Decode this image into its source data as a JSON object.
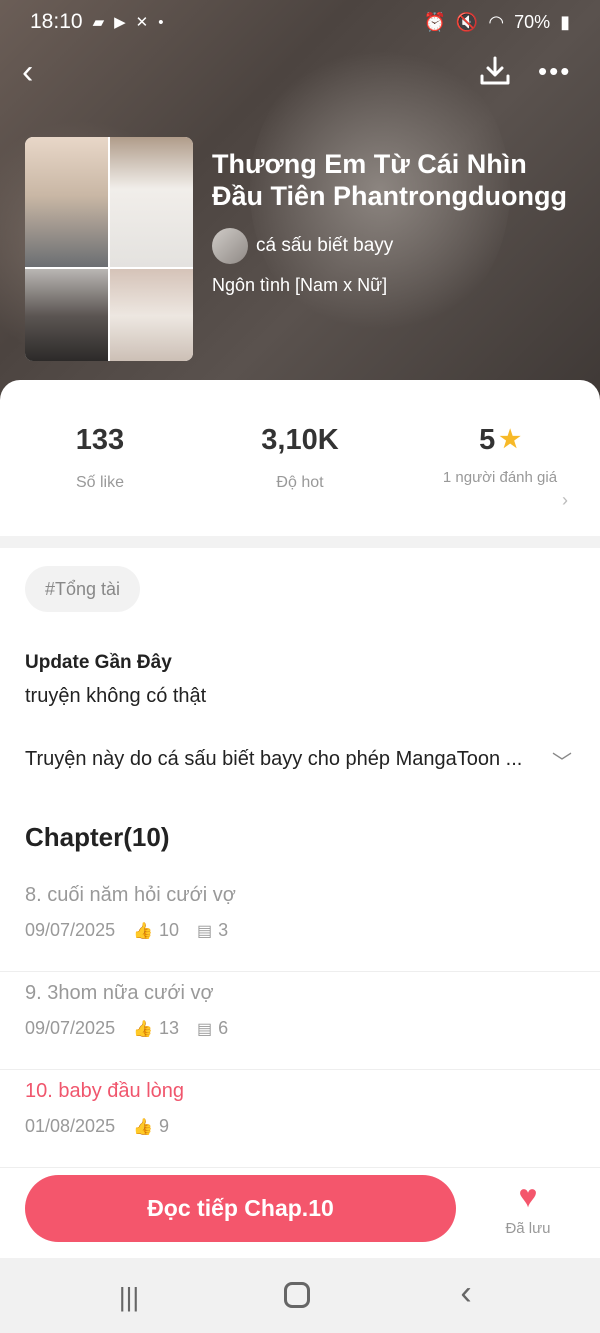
{
  "status_bar": {
    "time": "18:10",
    "battery": "70%"
  },
  "manga": {
    "title": "Thương Em Từ Cái Nhìn Đầu Tiên Phantrongduongg",
    "author": "cá sấu biết bayy",
    "genre": "Ngôn tình [Nam x Nữ]"
  },
  "stats": {
    "likes_value": "133",
    "likes_label": "Số like",
    "hot_value": "3,10K",
    "hot_label": "Độ hot",
    "rating_value": "5",
    "rating_label": "1 người đánh giá"
  },
  "tag": "#Tổng tài",
  "update": {
    "heading": "Update Gần Đây",
    "text": "truyện không có thật"
  },
  "description": "Truyện này do cá sấu biết bayy cho phép MangaToon ...",
  "chapters_header": "Chapter(10)",
  "chapters": [
    {
      "title": "8. cuối năm hỏi cưới vợ",
      "date": "09/07/2025",
      "likes": "10",
      "comments": "3"
    },
    {
      "title": "9. 3hom nữa cưới vợ",
      "date": "09/07/2025",
      "likes": "13",
      "comments": "6"
    },
    {
      "title": "10. baby đầu lòng",
      "date": "01/08/2025",
      "likes": "9"
    }
  ],
  "actions": {
    "read_button": "Đọc tiếp Chap.10",
    "saved_label": "Đã lưu"
  },
  "colors": {
    "accent": "#f4566c",
    "rating_star": "#f7b928"
  }
}
